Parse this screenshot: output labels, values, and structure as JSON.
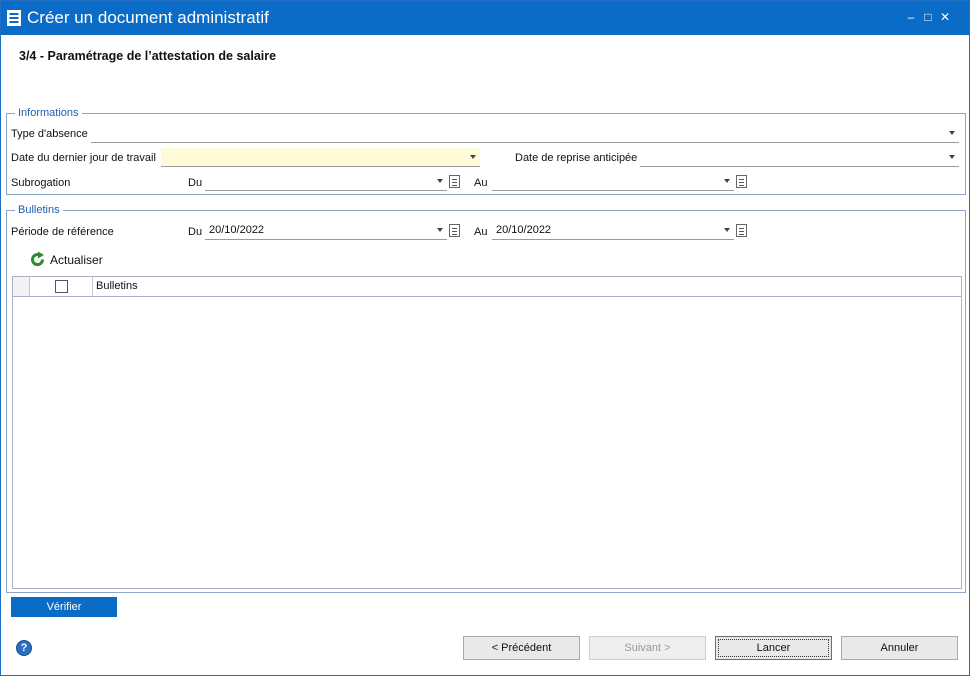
{
  "window": {
    "title": "Créer un document administratif",
    "controls": {
      "minimize": "‒",
      "maximize": "□",
      "close": "✕"
    }
  },
  "step_title": "3/4 - Paramétrage de l’attestation de salaire",
  "informations": {
    "legend": "Informations",
    "type_absence_label": "Type d'absence",
    "type_absence_value": "",
    "dernier_jour_label": "Date du dernier jour de travail",
    "dernier_jour_value": "",
    "reprise_label": "Date de reprise anticipée",
    "reprise_value": "",
    "subrogation_label": "Subrogation",
    "du_label": "Du",
    "du_value": "",
    "au_label": "Au",
    "au_value": ""
  },
  "bulletins": {
    "legend": "Bulletins",
    "periode_label": "Période de référence",
    "du_label": "Du",
    "du_value": "20/10/2022",
    "au_label": "Au",
    "au_value": "20/10/2022",
    "refresh_label": "Actualiser",
    "grid_column": "Bulletins",
    "rows": []
  },
  "buttons": {
    "verify": "Vérifier",
    "previous": "< Précédent",
    "next": "Suivant >",
    "launch": "Lancer",
    "cancel": "Annuler"
  },
  "help_glyph": "?",
  "colors": {
    "titlebar": "#0a6cc6",
    "accent": "#1a5fb4",
    "highlight_field": "#fdfbd8",
    "refresh_icon": "#2e8b2e"
  },
  "icons": [
    "app-menu-icon",
    "dropdown-arrow-icon",
    "calendar-icon",
    "refresh-icon",
    "help-icon",
    "checkbox-icon"
  ]
}
